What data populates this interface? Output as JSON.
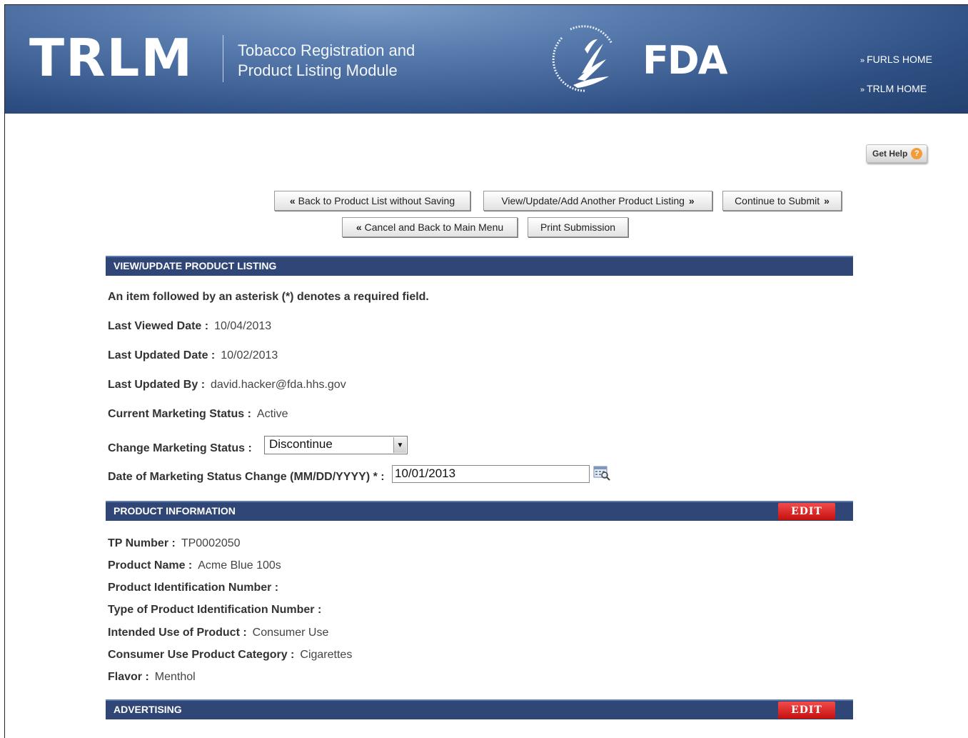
{
  "header": {
    "logo": "TRLM",
    "subtitle_line1": "Tobacco Registration and",
    "subtitle_line2": "Product Listing Module",
    "agency_logo": "FDA",
    "links": [
      {
        "label": "FURLS HOME"
      },
      {
        "label": "TRLM HOME"
      }
    ]
  },
  "help": {
    "label": "Get Help",
    "icon": "question-icon"
  },
  "buttons": {
    "back_list": "Back to Product List without Saving",
    "view_update_add": "View/Update/Add Another Product Listing",
    "continue_submit": "Continue to Submit",
    "cancel_main": "Cancel and Back to Main Menu",
    "print": "Print Submission"
  },
  "sections": {
    "view_update": "VIEW/UPDATE PRODUCT LISTING",
    "product_info": "PRODUCT INFORMATION",
    "advertising": "ADVERTISING",
    "edit_label": "EDIT"
  },
  "required_note": "An item followed by an asterisk (*) denotes a required field.",
  "listing": {
    "last_viewed": {
      "label": "Last Viewed Date :",
      "value": "10/04/2013"
    },
    "last_updated": {
      "label": "Last Updated Date :",
      "value": "10/02/2013"
    },
    "last_updated_by": {
      "label": "Last Updated By :",
      "value": "david.hacker@fda.hhs.gov"
    },
    "current_status": {
      "label": "Current Marketing Status :",
      "value": "Active"
    },
    "change_status": {
      "label": "Change Marketing Status :",
      "value": "Discontinue"
    },
    "status_change_date": {
      "label": "Date of Marketing Status Change (MM/DD/YYYY) * :",
      "value": "10/01/2013"
    }
  },
  "product": {
    "tp_number": {
      "label": "TP Number :",
      "value": "TP0002050"
    },
    "product_name": {
      "label": "Product Name :",
      "value": "Acme Blue 100s"
    },
    "pid_number": {
      "label": "Product Identification Number :",
      "value": ""
    },
    "pid_type": {
      "label": "Type of Product Identification Number :",
      "value": ""
    },
    "intended_use": {
      "label": "Intended Use of Product :",
      "value": "Consumer Use"
    },
    "category": {
      "label": "Consumer Use Product Category :",
      "value": "Cigarettes"
    },
    "flavor": {
      "label": "Flavor :",
      "value": "Menthol"
    }
  },
  "colors": {
    "section_bar": "#2f4676",
    "edit_button": "#d91c1c",
    "header": "#2e4f83",
    "help_icon": "#f39c3a"
  }
}
